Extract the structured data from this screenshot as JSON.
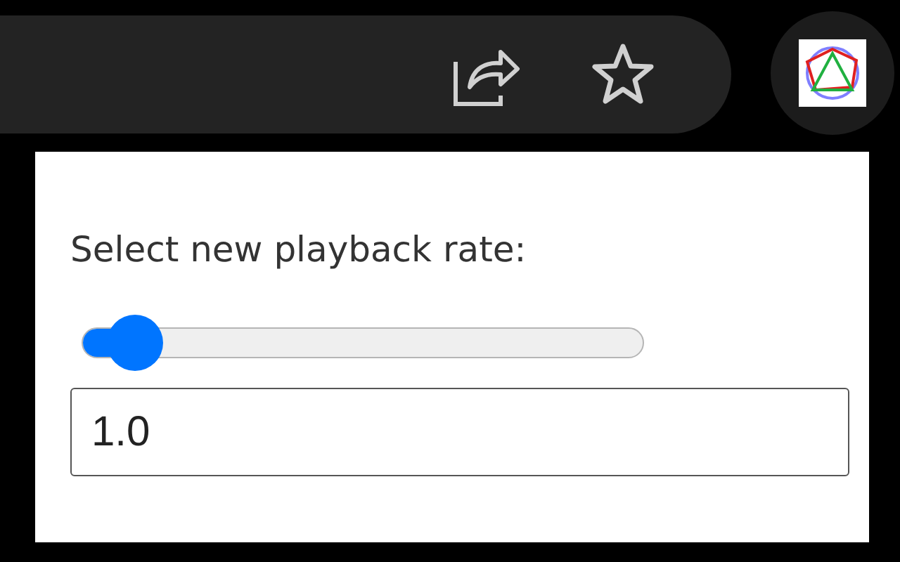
{
  "toolbar": {
    "extension_active": true
  },
  "popup": {
    "prompt": "Select new playback rate:",
    "slider": {
      "level": 0.05
    },
    "rate_field": {
      "value": "1.0"
    }
  }
}
